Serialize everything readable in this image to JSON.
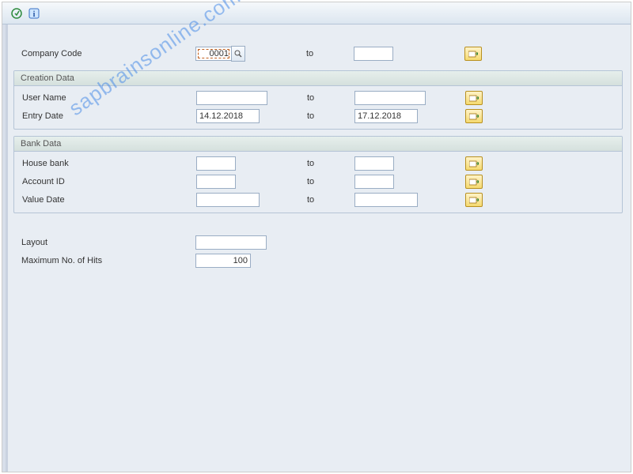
{
  "toolbar": {
    "execute_icon": "execute",
    "info_icon": "info"
  },
  "watermark": "sapbrainsonline.com",
  "company_code": {
    "label": "Company Code",
    "value_from": "0001",
    "to_label": "to",
    "value_to": ""
  },
  "groups": {
    "creation": {
      "title": "Creation Data",
      "user_name": {
        "label": "User Name",
        "from": "",
        "to_label": "to",
        "to": ""
      },
      "entry_date": {
        "label": "Entry Date",
        "from": "14.12.2018",
        "to_label": "to",
        "to": "17.12.2018"
      }
    },
    "bank": {
      "title": "Bank Data",
      "house_bank": {
        "label": "House bank",
        "from": "",
        "to_label": "to",
        "to": ""
      },
      "account_id": {
        "label": "Account ID",
        "from": "",
        "to_label": "to",
        "to": ""
      },
      "value_date": {
        "label": "Value Date",
        "from": "",
        "to_label": "to",
        "to": ""
      }
    }
  },
  "layout": {
    "label": "Layout",
    "value": ""
  },
  "max_hits": {
    "label": "Maximum No. of Hits",
    "value": "100"
  }
}
